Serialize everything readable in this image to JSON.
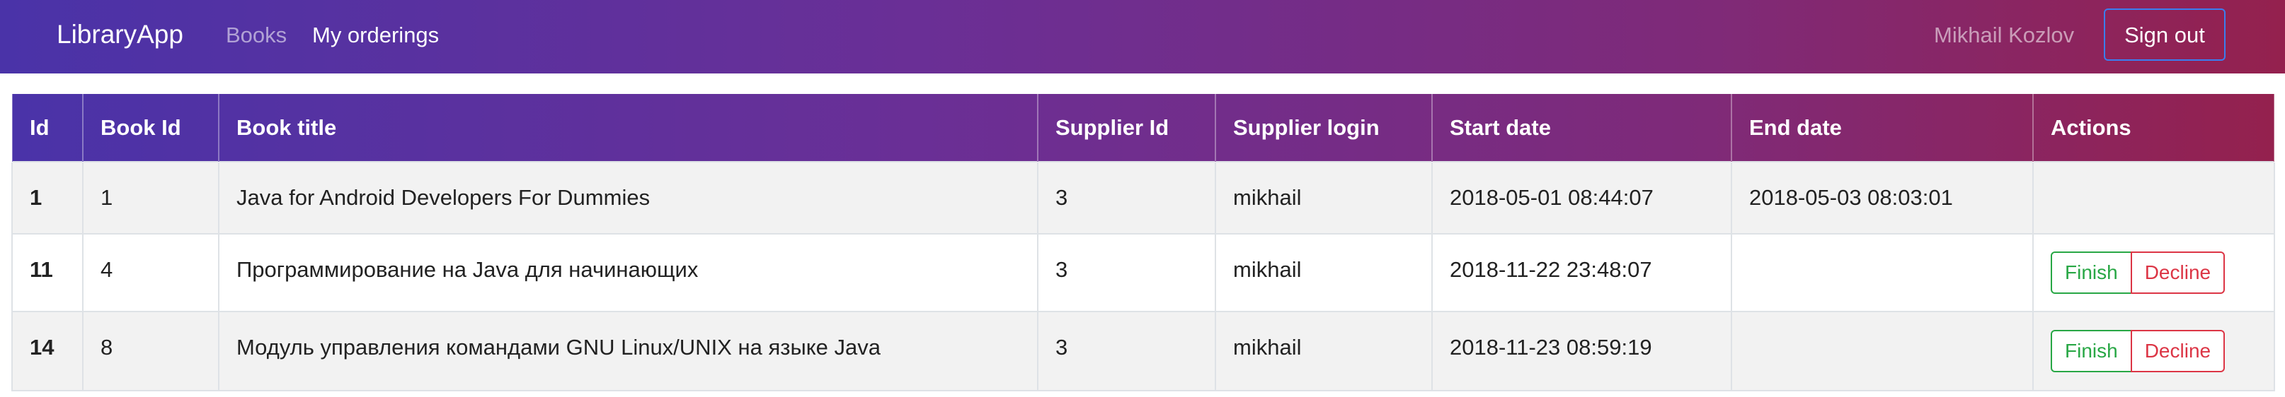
{
  "navbar": {
    "brand": "LibraryApp",
    "links": [
      "Books",
      "My orderings"
    ],
    "user_name": "Mikhail Kozlov",
    "signout_label": "Sign out"
  },
  "table": {
    "headers": [
      "Id",
      "Book Id",
      "Book title",
      "Supplier Id",
      "Supplier login",
      "Start date",
      "End date",
      "Actions"
    ],
    "rows": [
      {
        "id": "1",
        "book_id": "1",
        "title": "Java for Android Developers For Dummies",
        "supplier_id": "3",
        "supplier_login": "mikhail",
        "start_date": "2018-05-01 08:44:07",
        "end_date": "2018-05-03 08:03:01",
        "actions": []
      },
      {
        "id": "11",
        "book_id": "4",
        "title": "Программирование на Java для начинающих",
        "supplier_id": "3",
        "supplier_login": "mikhail",
        "start_date": "2018-11-22 23:48:07",
        "end_date": "",
        "actions": [
          "Finish",
          "Decline"
        ]
      },
      {
        "id": "14",
        "book_id": "8",
        "title": "Модуль управления командами GNU Linux/UNIX на языке Java",
        "supplier_id": "3",
        "supplier_login": "mikhail",
        "start_date": "2018-11-23 08:59:19",
        "end_date": "",
        "actions": [
          "Finish",
          "Decline"
        ]
      }
    ]
  },
  "colors": {
    "gradient_start": "#4a33a8",
    "gradient_end": "#94214e",
    "finish": "#28a745",
    "decline": "#dc3545",
    "signout_border": "#3a7ef0"
  }
}
